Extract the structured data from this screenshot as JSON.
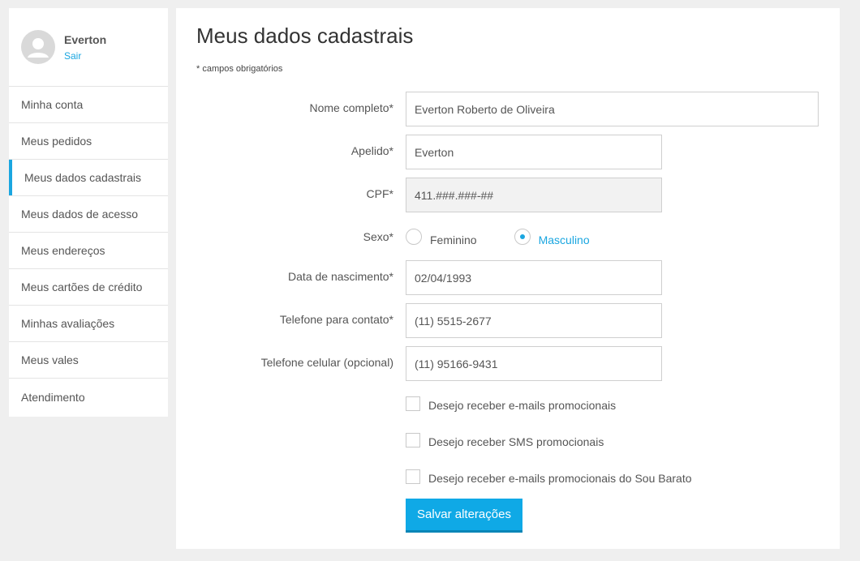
{
  "sidebar": {
    "user_name": "Everton",
    "logout_label": "Sair",
    "items": [
      {
        "label": "Minha conta"
      },
      {
        "label": "Meus pedidos"
      },
      {
        "label": "Meus dados cadastrais",
        "active": true
      },
      {
        "label": "Meus dados de acesso"
      },
      {
        "label": "Meus endereços"
      },
      {
        "label": "Meus cartões de crédito"
      },
      {
        "label": "Minhas avaliações"
      },
      {
        "label": "Meus vales"
      },
      {
        "label": "Atendimento"
      }
    ]
  },
  "main": {
    "title": "Meus dados cadastrais",
    "required_note": "* campos obrigatórios",
    "form": {
      "full_name": {
        "label": "Nome completo*",
        "value": "Everton Roberto de Oliveira"
      },
      "nickname": {
        "label": "Apelido*",
        "value": "Everton"
      },
      "cpf": {
        "label": "CPF*",
        "value": "411.###.###-##"
      },
      "sex": {
        "label": "Sexo*",
        "options": [
          "Feminino",
          "Masculino"
        ],
        "selected": "Masculino"
      },
      "birth_date": {
        "label": "Data de nascimento*",
        "value": "02/04/1993"
      },
      "phone": {
        "label": "Telefone para contato*",
        "value": "(11) 5515-2677"
      },
      "mobile": {
        "label": "Telefone celular (opcional)",
        "value": "(11) 95166-9431"
      }
    },
    "checkboxes": [
      {
        "label": "Desejo receber e-mails promocionais",
        "checked": false
      },
      {
        "label": "Desejo receber SMS promocionais",
        "checked": false
      },
      {
        "label": "Desejo receber e-mails promocionais do Sou Barato",
        "checked": false
      }
    ],
    "save_label": "Salvar alterações"
  },
  "colors": {
    "accent": "#1aa6e0",
    "button": "#0fa9e6",
    "background": "#efefef"
  }
}
